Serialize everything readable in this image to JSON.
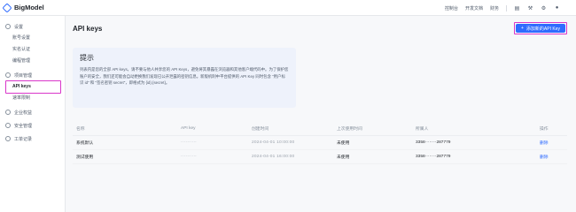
{
  "brand": {
    "name": "BigModel"
  },
  "topnav": {
    "items": [
      "控制台",
      "开发文档",
      "财务"
    ]
  },
  "sidebar": {
    "groups": [
      {
        "label": "设置",
        "items": [
          "账号设置",
          "实名认证",
          "编程管理"
        ]
      },
      {
        "label": "项目管理",
        "items": [
          "API keys",
          "速率限制"
        ]
      },
      {
        "label": "企业权益",
        "items": []
      },
      {
        "label": "安全管理",
        "items": []
      },
      {
        "label": "工单记录",
        "items": []
      }
    ]
  },
  "main": {
    "title": "API keys",
    "add_button": "添加新的API Key",
    "tip": {
      "title": "提示",
      "text": "列表内是您的全部 API keys，请不要与他人共享您的 API Keys，避免将其暴露在浏览器和其他客户端代码中。为了保护您账户的安全，我们还可能会自动更换我们发现已公开泄露的密钥信息。新版机制中平台提供的 API Key 同时包含 \"用户标识 id\" 和 \"签名密钥 secret\"，即格式为 {id}.{secret}。"
    },
    "table": {
      "headers": [
        "名称",
        "API key",
        "创建时间",
        "上次使用时间",
        "所属人",
        "操作"
      ],
      "rows": [
        {
          "name": "系统默认",
          "key": "··········",
          "created": "2024-04-01 10:00:00",
          "last_used": "未使用",
          "owner": "3358········287779",
          "action": "删除"
        },
        {
          "name": "测试使用",
          "key": "··········",
          "created": "2024-04-01 16:00:00",
          "last_used": "未使用",
          "owner": "3358········287779",
          "action": "删除"
        }
      ]
    }
  }
}
